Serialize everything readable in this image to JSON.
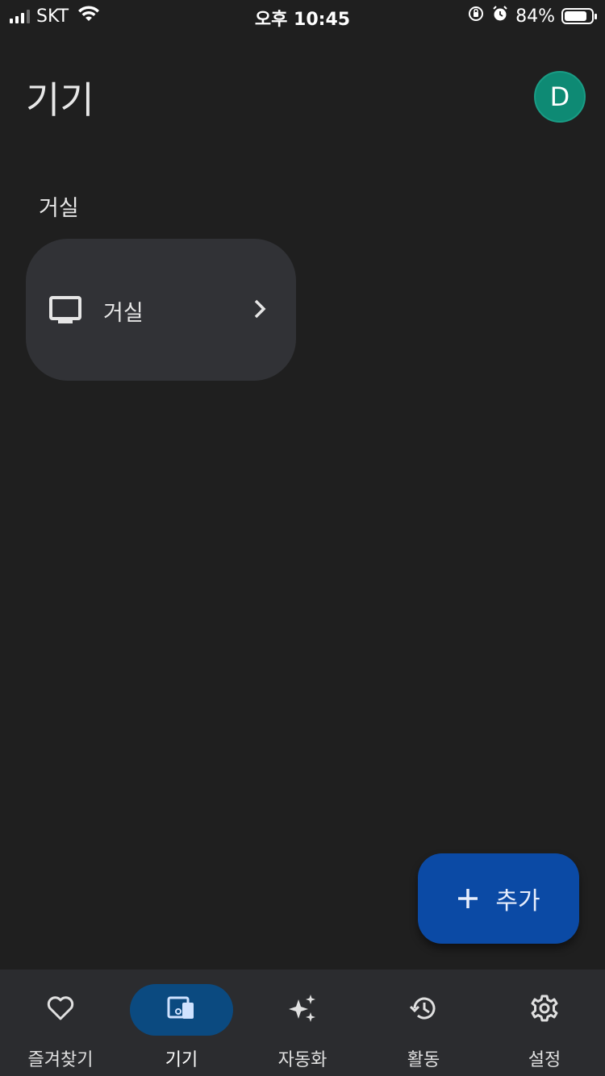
{
  "status_bar": {
    "carrier": "SKT",
    "time": "오후 10:45",
    "battery": "84%",
    "battery_level": 0.84
  },
  "header": {
    "title": "기기",
    "avatar_initial": "D"
  },
  "section": {
    "title": "거실"
  },
  "room_card": {
    "label": "거실",
    "icon": "tv-icon"
  },
  "fab": {
    "label": "추가"
  },
  "bottom_nav": {
    "items": [
      {
        "label": "즐겨찾기",
        "icon": "heart-icon",
        "active": false
      },
      {
        "label": "기기",
        "icon": "devices-icon",
        "active": true
      },
      {
        "label": "자동화",
        "icon": "sparkle-icon",
        "active": false
      },
      {
        "label": "활동",
        "icon": "history-icon",
        "active": false
      },
      {
        "label": "설정",
        "icon": "gear-icon",
        "active": false
      }
    ]
  },
  "colors": {
    "background": "#1f1f1f",
    "card": "#313236",
    "fab": "#0b4aa5",
    "nav_active": "#0b4a80",
    "avatar": "#0e8a74"
  }
}
